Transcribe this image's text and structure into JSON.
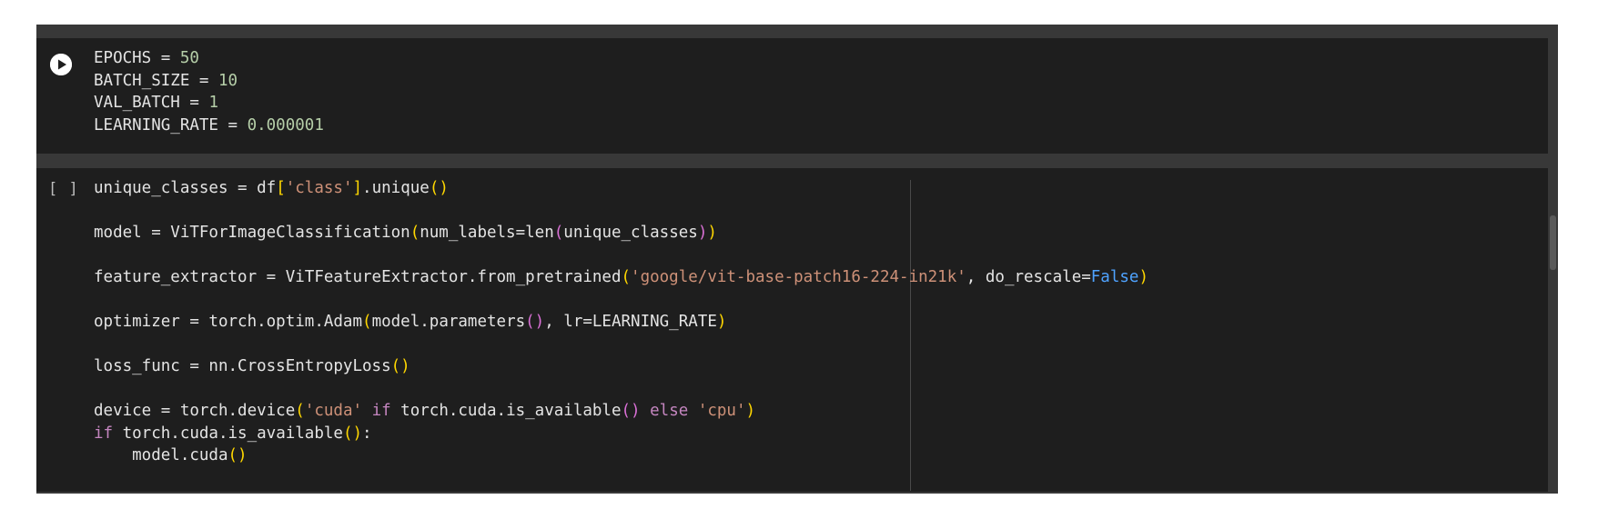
{
  "cell1": {
    "run_icon": "play-circle-icon",
    "lines": [
      [
        "EPOCHS = ",
        "50"
      ],
      [
        "BATCH_SIZE = ",
        "10"
      ],
      [
        "VAL_BATCH = ",
        "1"
      ],
      [
        "LEARNING_RATE = ",
        "0.000001"
      ]
    ]
  },
  "cell2": {
    "execution_count": "[ ]",
    "tokens": {
      "l1a": "unique_classes = df",
      "l1b": "[",
      "l1c": "'class'",
      "l1d": "]",
      "l1e": ".unique",
      "l1f": "()",
      "l2a": "model = ViTForImageClassification",
      "l2b": "(",
      "l2c": "num_labels=len",
      "l2d": "(",
      "l2e": "unique_classes",
      "l2f": ")",
      "l2g": ")",
      "l3a": "feature_extractor = ViTFeatureExtractor.from_pretrained",
      "l3b": "(",
      "l3c": "'google/vit-base-patch16-224-in21k'",
      "l3d": ", do_rescale=",
      "l3e": "False",
      "l3f": ")",
      "l4a": "optimizer = torch.optim.Adam",
      "l4b": "(",
      "l4c": "model.parameters",
      "l4d": "()",
      "l4e": ", lr=LEARNING_RATE",
      "l4f": ")",
      "l5a": "loss_func = nn.CrossEntropyLoss",
      "l5b": "()",
      "l6a": "device = torch.device",
      "l6b": "(",
      "l6c": "'cuda'",
      "l6d": " if",
      "l6e": " torch.cuda.is_available",
      "l6f": "()",
      "l6g": " else",
      "l6h": " 'cpu'",
      "l6i": ")",
      "l7a": "if",
      "l7b": " torch.cuda.is_available",
      "l7c": "()",
      "l7d": ":",
      "l8a": "    model.cuda",
      "l8b": "()"
    }
  },
  "colors": {
    "cell_bg": "#1e1e1e",
    "gutter_bg": "#383838",
    "number": "#b5cea8",
    "string": "#ce9178",
    "keyword": "#c586c0",
    "boolean": "#4fa3ff",
    "bracket_1": "#ffd700",
    "bracket_2": "#da70d6"
  }
}
